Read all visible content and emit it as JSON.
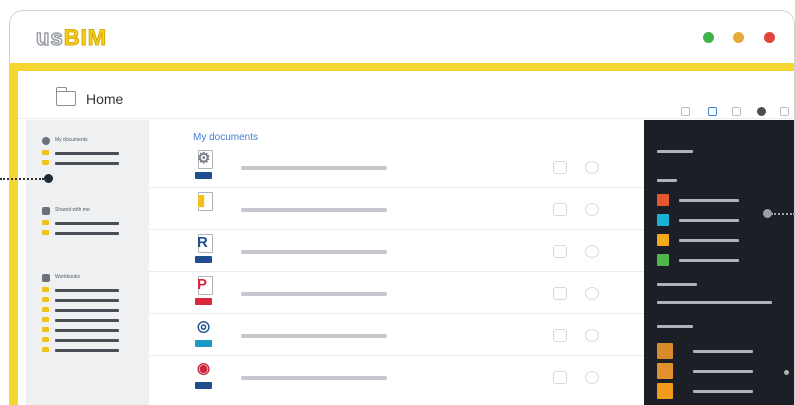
{
  "app": {
    "logo_prefix": "us",
    "logo_brand": "BIM",
    "window_dots": [
      "#3db14a",
      "#e9a83a",
      "#e0443c"
    ]
  },
  "header": {
    "title": "Home",
    "toolbar_icons": [
      "grid-view-icon",
      "list-view-icon",
      "filter-icon",
      "settings-icon",
      "more-icon"
    ]
  },
  "sidebar": {
    "sections": [
      {
        "label": "My documents",
        "icon": "user-icon",
        "rows": 2
      },
      {
        "label": "Shared with me",
        "icon": "shared-icon",
        "rows": 2
      },
      {
        "label": "Workbooks",
        "icon": "book-icon",
        "rows": 8
      }
    ]
  },
  "main": {
    "title": "My documents",
    "files": [
      {
        "type": "ifc",
        "icon": "ifc-file-icon",
        "color": "#7a8088"
      },
      {
        "type": "folder",
        "icon": "folder-file-icon",
        "color": "#f1c21b"
      },
      {
        "type": "revit",
        "icon": "revit-file-icon",
        "color": "#1f4f8f"
      },
      {
        "type": "pdf",
        "icon": "pdf-file-icon",
        "color": "#d7263d"
      },
      {
        "type": "model",
        "icon": "model-file-icon",
        "color": "#1f4f8f"
      },
      {
        "type": "model",
        "icon": "model-file-icon",
        "color": "#c8283c"
      }
    ]
  },
  "panel": {
    "swatches": [
      "#e4572e",
      "#19b1d6",
      "#f2a91c",
      "#4cb74a"
    ],
    "bottom_swatches": [
      "#d98a2b",
      "#e0902c",
      "#f29a1c"
    ]
  }
}
